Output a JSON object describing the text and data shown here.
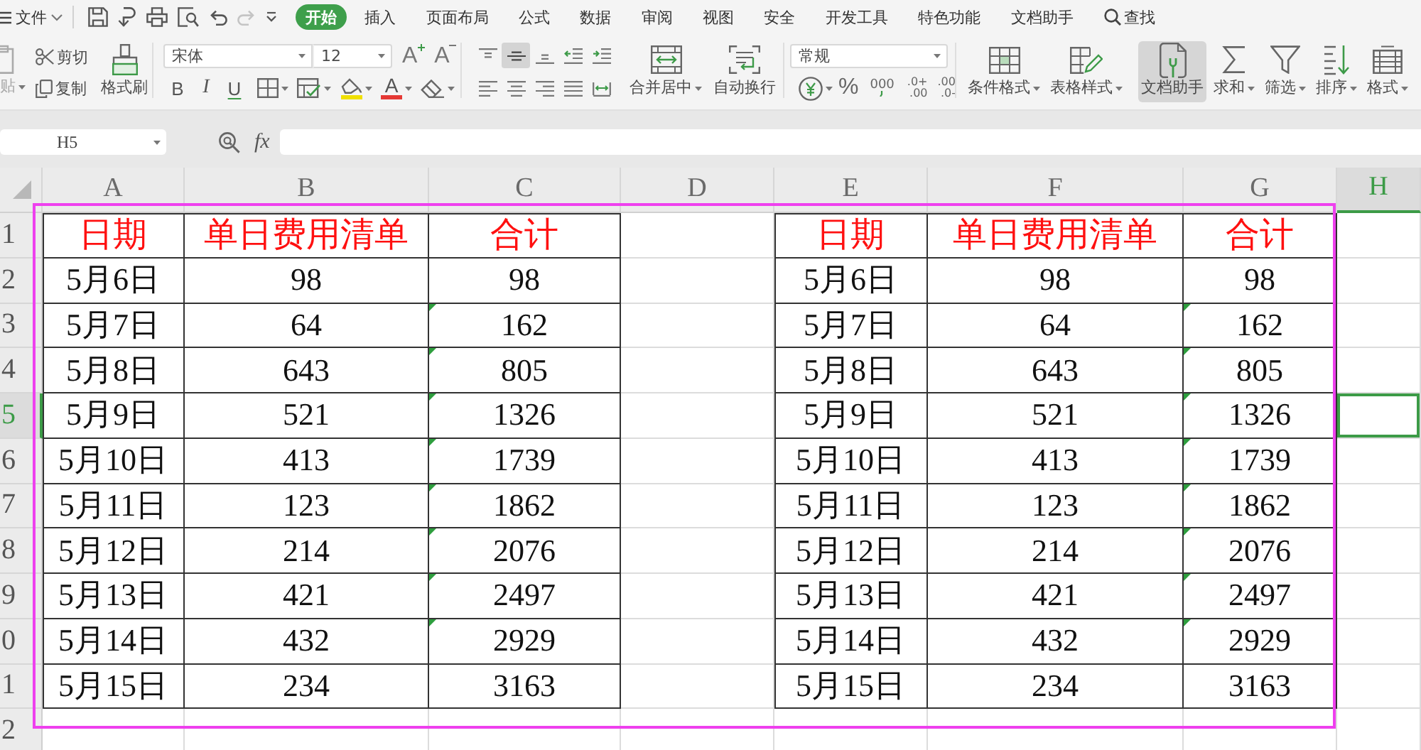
{
  "menu_bar": {
    "file_menu": "文件",
    "quick_access": [
      {
        "kind": "save",
        "disabled": false
      },
      {
        "kind": "export",
        "disabled": false
      },
      {
        "kind": "print",
        "disabled": false
      },
      {
        "kind": "preview",
        "disabled": false
      },
      {
        "kind": "undo",
        "disabled": false
      },
      {
        "kind": "redo",
        "disabled": true
      },
      {
        "kind": "customize",
        "disabled": false
      }
    ],
    "tabs": [
      {
        "label": "开始",
        "selected": true
      },
      {
        "label": "插入",
        "selected": false
      },
      {
        "label": "页面布局",
        "selected": false
      },
      {
        "label": "公式",
        "selected": false
      },
      {
        "label": "数据",
        "selected": false
      },
      {
        "label": "审阅",
        "selected": false
      },
      {
        "label": "视图",
        "selected": false
      },
      {
        "label": "安全",
        "selected": false
      },
      {
        "label": "开发工具",
        "selected": false
      },
      {
        "label": "特色功能",
        "selected": false
      },
      {
        "label": "文档助手",
        "selected": false
      }
    ],
    "search": "查找"
  },
  "ribbon": {
    "paste": {
      "label": "贴",
      "disabled": true
    },
    "clipboard": [
      {
        "kind": "cut",
        "label": "剪切"
      },
      {
        "kind": "copy",
        "label": "复制"
      }
    ],
    "format_painter": "格式刷",
    "font_name": "宋体",
    "font_size": "12",
    "size_buttons": [
      {
        "kind": "grow",
        "label": "A"
      },
      {
        "kind": "shrink",
        "label": "A"
      }
    ],
    "style_buttons": [
      {
        "kind": "bold",
        "label": "B"
      },
      {
        "kind": "italic",
        "label": "I"
      },
      {
        "kind": "underline",
        "label": "U"
      }
    ],
    "format_buttons": [
      {
        "kind": "borders"
      },
      {
        "kind": "cell-style"
      },
      {
        "kind": "fill",
        "color": "#f0e000"
      },
      {
        "kind": "font-color",
        "label": "A",
        "color": "#e53935"
      },
      {
        "kind": "clear"
      }
    ],
    "align_buttons": [
      {
        "kind": "top",
        "selected": false
      },
      {
        "kind": "middle",
        "selected": true
      },
      {
        "kind": "bottom",
        "selected": false
      },
      {
        "kind": "outdent",
        "selected": false
      },
      {
        "kind": "indent",
        "selected": false
      },
      {
        "kind": "left",
        "selected": false
      },
      {
        "kind": "center",
        "selected": false
      },
      {
        "kind": "right",
        "selected": false
      },
      {
        "kind": "justify",
        "selected": false
      },
      {
        "kind": "distribute",
        "selected": false
      }
    ],
    "merge": "合并居中",
    "wrap": "自动换行",
    "number_format": "常规",
    "number_buttons": [
      {
        "kind": "currency"
      },
      {
        "kind": "percent",
        "label": "%"
      },
      {
        "kind": "thousands",
        "label": "000"
      },
      {
        "kind": "add-decimal",
        "lines": [
          ".0+",
          ".00"
        ]
      },
      {
        "kind": "remove-decimal",
        "lines": [
          ".00",
          ".0-"
        ]
      }
    ],
    "tools": [
      {
        "kind": "conditional",
        "label": "条件格式",
        "menu": true,
        "selected": false
      },
      {
        "kind": "table-style",
        "label": "表格样式",
        "menu": true,
        "selected": false
      },
      {
        "kind": "assistant",
        "label": "文档助手",
        "menu": false,
        "selected": true
      },
      {
        "kind": "sum",
        "label": "求和",
        "menu": true,
        "selected": false
      },
      {
        "kind": "filter",
        "label": "筛选",
        "menu": true,
        "selected": false
      },
      {
        "kind": "sort",
        "label": "排序",
        "menu": true,
        "selected": false
      },
      {
        "kind": "format",
        "label": "格式",
        "menu": true,
        "selected": false
      }
    ]
  },
  "formula_bar": {
    "name_box": "H5",
    "fx": "fx"
  },
  "sheet": {
    "columns": [
      {
        "label": "A",
        "selected": false
      },
      {
        "label": "B",
        "selected": false
      },
      {
        "label": "C",
        "selected": false
      },
      {
        "label": "D",
        "selected": false
      },
      {
        "label": "E",
        "selected": false
      },
      {
        "label": "F",
        "selected": false
      },
      {
        "label": "G",
        "selected": false
      },
      {
        "label": "H",
        "selected": true
      }
    ],
    "rows": [
      {
        "label": "1",
        "selected": false
      },
      {
        "label": "2",
        "selected": false
      },
      {
        "label": "3",
        "selected": false
      },
      {
        "label": "4",
        "selected": false
      },
      {
        "label": "5",
        "selected": true
      },
      {
        "label": "6",
        "selected": false
      },
      {
        "label": "7",
        "selected": false
      },
      {
        "label": "8",
        "selected": false
      },
      {
        "label": "9",
        "selected": false
      },
      {
        "label": "0",
        "selected": false
      },
      {
        "label": "1",
        "selected": false
      },
      {
        "label": "2",
        "selected": false
      }
    ],
    "tables": [
      {
        "header": [
          "日期",
          "单日费用清单",
          "合计"
        ],
        "rows": [
          {
            "cells": [
              "5月6日",
              "98",
              "98"
            ],
            "flagged": false
          },
          {
            "cells": [
              "5月7日",
              "64",
              "162"
            ],
            "flagged": true
          },
          {
            "cells": [
              "5月8日",
              "643",
              "805"
            ],
            "flagged": true
          },
          {
            "cells": [
              "5月9日",
              "521",
              "1326"
            ],
            "flagged": true
          },
          {
            "cells": [
              "5月10日",
              "413",
              "1739"
            ],
            "flagged": true
          },
          {
            "cells": [
              "5月11日",
              "123",
              "1862"
            ],
            "flagged": true
          },
          {
            "cells": [
              "5月12日",
              "214",
              "2076"
            ],
            "flagged": true
          },
          {
            "cells": [
              "5月13日",
              "421",
              "2497"
            ],
            "flagged": true
          },
          {
            "cells": [
              "5月14日",
              "432",
              "2929"
            ],
            "flagged": true
          },
          {
            "cells": [
              "5月15日",
              "234",
              "3163"
            ],
            "flagged": false
          }
        ]
      },
      {
        "header": [
          "日期",
          "单日费用清单",
          "合计"
        ],
        "rows": [
          {
            "cells": [
              "5月6日",
              "98",
              "98"
            ],
            "flagged": false
          },
          {
            "cells": [
              "5月7日",
              "64",
              "162"
            ],
            "flagged": true
          },
          {
            "cells": [
              "5月8日",
              "643",
              "805"
            ],
            "flagged": true
          },
          {
            "cells": [
              "5月9日",
              "521",
              "1326"
            ],
            "flagged": true
          },
          {
            "cells": [
              "5月10日",
              "413",
              "1739"
            ],
            "flagged": true
          },
          {
            "cells": [
              "5月11日",
              "123",
              "1862"
            ],
            "flagged": true
          },
          {
            "cells": [
              "5月12日",
              "214",
              "2076"
            ],
            "flagged": true
          },
          {
            "cells": [
              "5月13日",
              "421",
              "2497"
            ],
            "flagged": true
          },
          {
            "cells": [
              "5月14日",
              "432",
              "2929"
            ],
            "flagged": true
          },
          {
            "cells": [
              "5月15日",
              "234",
              "3163"
            ],
            "flagged": false
          }
        ]
      }
    ]
  }
}
